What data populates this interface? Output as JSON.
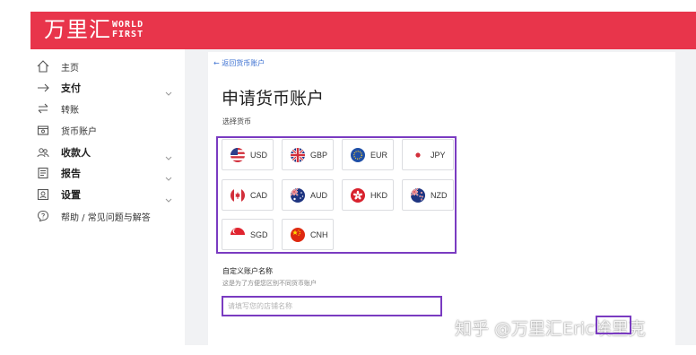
{
  "header": {
    "logo_zh": "万里汇",
    "logo_en_line1": "WORLD",
    "logo_en_line2": "FIRST",
    "bg_color": "#e8354b"
  },
  "sidebar": {
    "items": [
      {
        "label": "主页",
        "icon": "home-icon",
        "has_chevron": false
      },
      {
        "label": "支付",
        "icon": "arrow-right-icon",
        "has_chevron": true
      },
      {
        "label": "转账",
        "icon": "transfer-icon",
        "has_chevron": false
      },
      {
        "label": "货币账户",
        "icon": "wallet-icon",
        "has_chevron": false
      },
      {
        "label": "收款人",
        "icon": "people-icon",
        "has_chevron": true
      },
      {
        "label": "报告",
        "icon": "report-icon",
        "has_chevron": true
      },
      {
        "label": "设置",
        "icon": "settings-icon",
        "has_chevron": true
      },
      {
        "label": "帮助 / 常见问题与解答",
        "icon": "help-icon",
        "has_chevron": false
      }
    ]
  },
  "main": {
    "back_link": "← 返回货币账户",
    "title": "申请货币账户",
    "select_label": "选择货币",
    "currencies": [
      {
        "code": "USD",
        "icon": "us-flag-icon"
      },
      {
        "code": "GBP",
        "icon": "uk-flag-icon"
      },
      {
        "code": "EUR",
        "icon": "eu-flag-icon"
      },
      {
        "code": "JPY",
        "icon": "japan-flag-icon"
      },
      {
        "code": "CAD",
        "icon": "canada-flag-icon"
      },
      {
        "code": "AUD",
        "icon": "australia-flag-icon"
      },
      {
        "code": "HKD",
        "icon": "hongkong-flag-icon"
      },
      {
        "code": "NZD",
        "icon": "newzealand-flag-icon"
      },
      {
        "code": "SGD",
        "icon": "singapore-flag-icon"
      },
      {
        "code": "CNH",
        "icon": "china-flag-icon"
      }
    ],
    "custom_name_title": "自定义账户名称",
    "custom_name_hint": "这是为了方便您区别不同货币账户",
    "custom_name_placeholder": "请填写您的店铺名称",
    "custom_name_value": "",
    "highlight_color": "#7a3bc1"
  },
  "watermark": {
    "text": "知乎 @万里汇Eric埃里克"
  }
}
